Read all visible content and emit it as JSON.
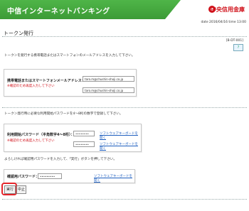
{
  "header": {
    "title": "中信インターネットバンキング",
    "bank_name": "中央信用金庫"
  },
  "date_line": "date 2016/04/16 time 13:00",
  "page_title": "トークン発行",
  "screen_id": "[B-DT-001]",
  "help_icon": "?",
  "section1": {
    "instruction": "トークンを発行する携帯電話またはスマートフォンのメールアドレスを入力して下さい。",
    "label": "携帯電話またはスマートフォンメールアドレス：",
    "note": "※確認のため再度入力して下さい",
    "email_value": "taro.m@chushin-shoji.co.jp",
    "email_confirm_value": "taro.m@chushin-shoji.co.jp"
  },
  "section2": {
    "instruction": "トークン発行時に必要な利用開始パスワードを4～8桁の数字で登録して下さい。",
    "label": "利用開始パスワード（半角数字4～8桁）：",
    "note": "※確認のため再度入力して下さい",
    "password_value": "••••••••",
    "password_confirm_value": "••••••••",
    "link1": "ソフトウェアキーボードを開く",
    "link2": "ソフトウェアキーボードを開く"
  },
  "section3": {
    "instruction": "よろしければ確認用パスワードを入力して、「実行」ボタンを押して下さい。",
    "label": "確認用パスワード：",
    "password_value": "•••••••••",
    "link": "ソフトウェアキーボードを開く"
  },
  "buttons": {
    "execute": "実行",
    "cancel": "中止"
  },
  "colors": {
    "header_green": "#3c9b36",
    "bank_red": "#d0121b",
    "highlight_red": "#e5242a",
    "link_blue": "#1f5fbf"
  }
}
